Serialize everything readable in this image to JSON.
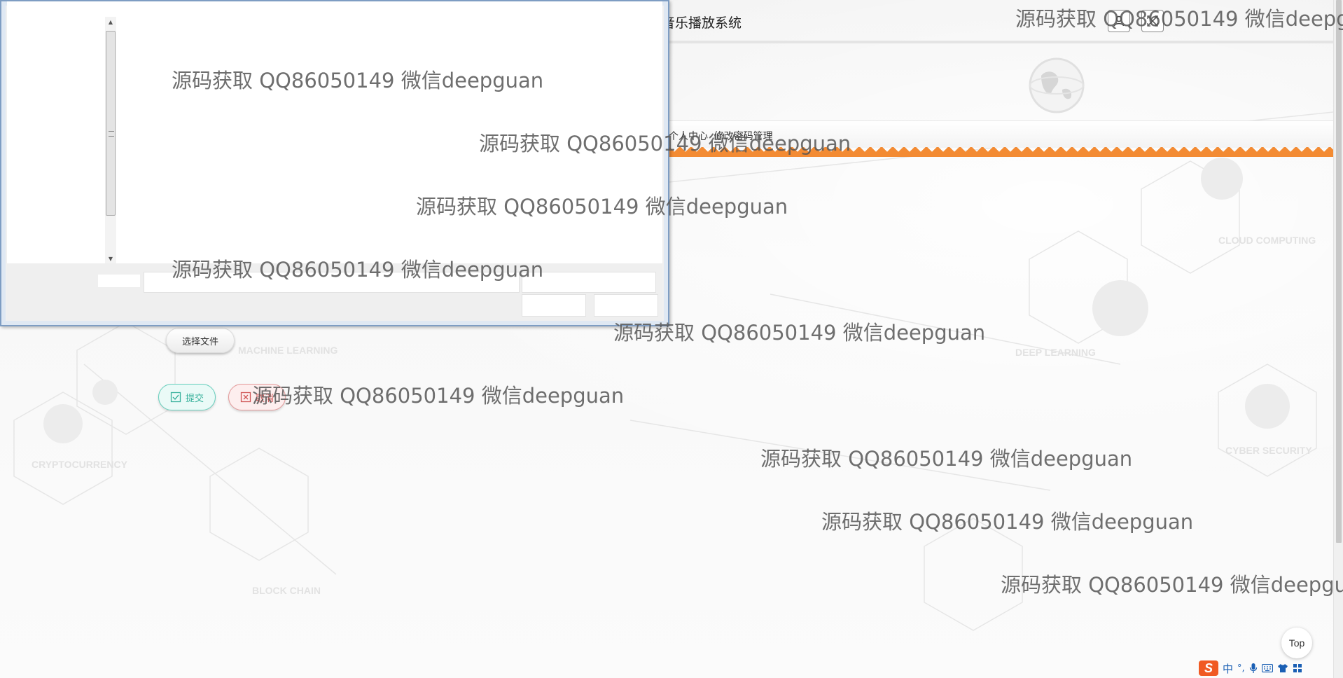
{
  "header": {
    "title": "音乐播放系统",
    "user_icon": "user-icon",
    "exit_icon": "exit-icon"
  },
  "breadcrumb": {
    "items": [
      "个人中心",
      "修改密码管理"
    ],
    "separator": "·"
  },
  "form": {
    "file_button": "选择文件",
    "submit_button": "提交",
    "cancel_button": "取消"
  },
  "top_button": "Top",
  "ime": {
    "logo": "S",
    "lang": "中",
    "punct": "°,",
    "icons": [
      "mic-icon",
      "keyboard-icon",
      "shirt-icon",
      "grid-icon"
    ]
  },
  "watermark": "源码获取 QQ86050149 微信deepguan",
  "colors": {
    "accent_orange": "#f38b33",
    "submit_teal": "#3ab29d",
    "cancel_red": "#d05757",
    "dialog_border": "#7e9dc3"
  }
}
